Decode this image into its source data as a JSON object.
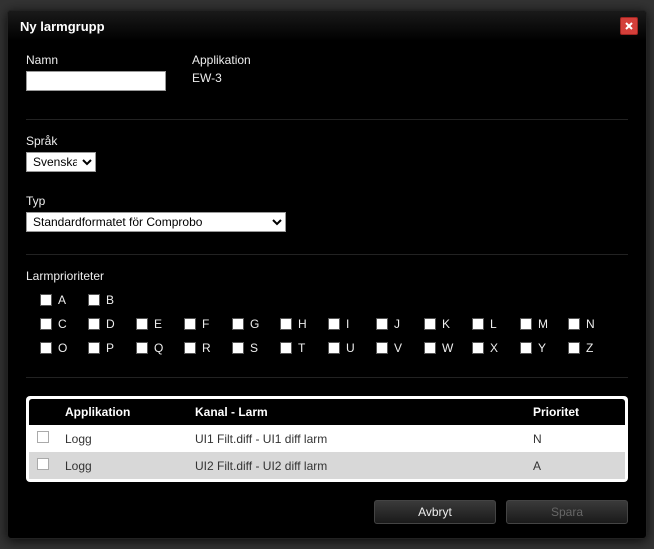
{
  "dialog": {
    "title": "Ny larmgrupp"
  },
  "fields": {
    "name_label": "Namn",
    "name_value": "",
    "app_label": "Applikation",
    "app_value": "EW-3",
    "lang_label": "Språk",
    "lang_value": "Svenska",
    "typ_label": "Typ",
    "typ_value": "Standardformatet för Comprobo",
    "prio_label": "Larmprioriteter"
  },
  "priorities_row1": [
    "A",
    "B"
  ],
  "priorities_row2": [
    "C",
    "D",
    "E",
    "F",
    "G",
    "H",
    "I",
    "J",
    "K",
    "L",
    "M",
    "N"
  ],
  "priorities_row3": [
    "O",
    "P",
    "Q",
    "R",
    "S",
    "T",
    "U",
    "V",
    "W",
    "X",
    "Y",
    "Z"
  ],
  "table": {
    "headers": {
      "app": "Applikation",
      "kanal": "Kanal - Larm",
      "prio": "Prioritet"
    },
    "rows": [
      {
        "app": "Logg",
        "kanal": "UI1 Filt.diff - UI1 diff larm",
        "prio": "N"
      },
      {
        "app": "Logg",
        "kanal": "UI2 Filt.diff - UI2 diff larm",
        "prio": "A"
      }
    ]
  },
  "buttons": {
    "cancel": "Avbryt",
    "save": "Spara"
  }
}
